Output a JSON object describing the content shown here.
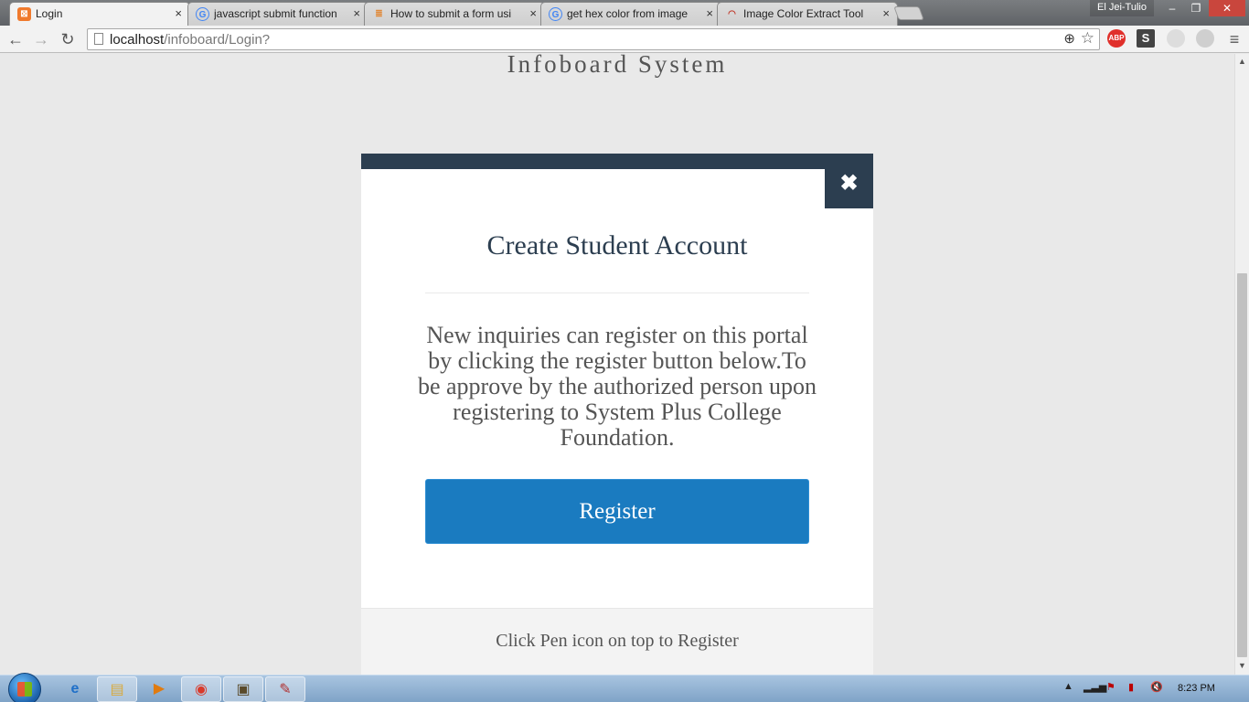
{
  "browser": {
    "tabs": [
      {
        "title": "Login",
        "icon": "xampp-icon",
        "active": true
      },
      {
        "title": "javascript submit function",
        "icon": "google-icon"
      },
      {
        "title": "How to submit a form usi",
        "icon": "stackoverflow-icon"
      },
      {
        "title": "get hex color from image",
        "icon": "google-icon"
      },
      {
        "title": "Image Color Extract Tool",
        "icon": "colortool-icon"
      }
    ],
    "close_glyph": "×",
    "profile_name": "El Jei-Tulio",
    "window_controls": {
      "minimize": "–",
      "restore": "❐",
      "close": "✕"
    },
    "url_host": "localhost",
    "url_path": "/infoboard/Login?",
    "extensions": [
      "ABP",
      "S"
    ]
  },
  "page": {
    "site_title": "Infoboard System",
    "modal": {
      "close_glyph": "✖",
      "title": "Create Student Account",
      "body": "New inquiries can register on this portal by clicking the register button below.To be approve by the authorized person upon registering to System Plus College Foundation.",
      "button_label": "Register",
      "footer_text": "Click Pen icon on top to Register"
    }
  },
  "taskbar": {
    "clock": "8:23 PM"
  },
  "colors": {
    "modal_header": "#2c3e50",
    "button": "#1a7bc0",
    "page_background": "#e9e9e9"
  }
}
